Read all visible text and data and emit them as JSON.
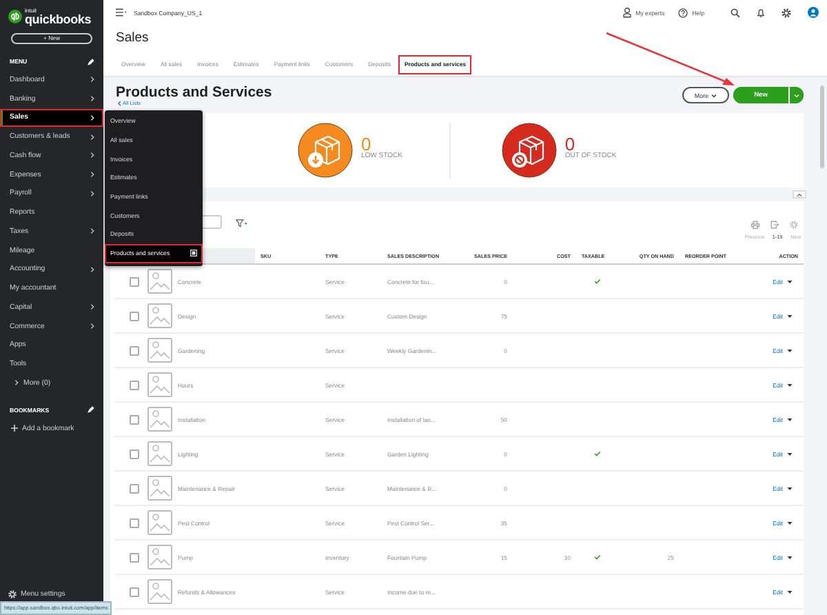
{
  "sidebar": {
    "logo": {
      "maker": "intuit",
      "brand": "quickbooks"
    },
    "new_button": "+ New",
    "menu_heading": "MENU",
    "items": [
      {
        "label": "Dashboard",
        "submenu": true,
        "selected": false,
        "annotated": false
      },
      {
        "label": "Banking",
        "submenu": true,
        "selected": false,
        "annotated": false
      },
      {
        "label": "Sales",
        "submenu": true,
        "selected": true,
        "annotated": true
      },
      {
        "label": "Customers & leads",
        "submenu": true,
        "selected": false,
        "annotated": false
      },
      {
        "label": "Cash flow",
        "submenu": true,
        "selected": false,
        "annotated": false
      },
      {
        "label": "Expenses",
        "submenu": true,
        "selected": false,
        "annotated": false
      },
      {
        "label": "Payroll",
        "submenu": true,
        "selected": false,
        "annotated": false
      },
      {
        "label": "Reports",
        "submenu": false,
        "selected": false,
        "annotated": false
      },
      {
        "label": "Taxes",
        "submenu": true,
        "selected": false,
        "annotated": false
      },
      {
        "label": "Mileage",
        "submenu": false,
        "selected": false,
        "annotated": false
      },
      {
        "label": "Accounting",
        "submenu": true,
        "selected": false,
        "annotated": false
      },
      {
        "label": "My accountant",
        "submenu": false,
        "selected": false,
        "annotated": false
      },
      {
        "label": "Capital",
        "submenu": true,
        "selected": false,
        "annotated": false
      },
      {
        "label": "Commerce",
        "submenu": true,
        "selected": false,
        "annotated": false
      },
      {
        "label": "Apps",
        "submenu": false,
        "selected": false,
        "annotated": false
      },
      {
        "label": "Tools",
        "submenu": false,
        "selected": false,
        "annotated": false
      }
    ],
    "more": "More (0)",
    "bookmarks_heading": "BOOKMARKS",
    "add_bookmark": "Add a bookmark",
    "settings": "Menu settings"
  },
  "flyout": {
    "items": [
      {
        "label": "Overview",
        "selected": false,
        "annotated": false
      },
      {
        "label": "All sales",
        "selected": false,
        "annotated": false
      },
      {
        "label": "Invoices",
        "selected": false,
        "annotated": false
      },
      {
        "label": "Estimates",
        "selected": false,
        "annotated": false
      },
      {
        "label": "Payment links",
        "selected": false,
        "annotated": false
      },
      {
        "label": "Customers",
        "selected": false,
        "annotated": false
      },
      {
        "label": "Deposits",
        "selected": false,
        "annotated": false
      },
      {
        "label": "Products and services",
        "selected": true,
        "annotated": true
      }
    ]
  },
  "topbar": {
    "company": "Sandbox Company_US_1",
    "experts": "My experts",
    "help": "Help"
  },
  "page_title": "Sales",
  "tabs": [
    {
      "label": "Overview",
      "selected": false,
      "annotated": false
    },
    {
      "label": "All sales",
      "selected": false,
      "annotated": false
    },
    {
      "label": "Invoices",
      "selected": false,
      "annotated": false
    },
    {
      "label": "Estimates",
      "selected": false,
      "annotated": false
    },
    {
      "label": "Payment links",
      "selected": false,
      "annotated": false
    },
    {
      "label": "Customers",
      "selected": false,
      "annotated": false
    },
    {
      "label": "Deposits",
      "selected": false,
      "annotated": false
    },
    {
      "label": "Products and services",
      "selected": true,
      "annotated": true
    }
  ],
  "section": {
    "title": "Products and Services",
    "back_link": "All Lists",
    "more_button": "More",
    "new_button": "New"
  },
  "stock": [
    {
      "kind": "low",
      "count": "0",
      "label": "LOW STOCK"
    },
    {
      "kind": "out",
      "count": "0",
      "label": "OUT OF STOCK"
    }
  ],
  "table": {
    "pagination": {
      "previous": "Previous",
      "range": "1-19",
      "next": "Next"
    },
    "columns": [
      "SKU",
      "TYPE",
      "SALES DESCRIPTION",
      "SALES PRICE",
      "COST",
      "TAXABLE",
      "QTY ON HAND",
      "REORDER POINT",
      "ACTION"
    ],
    "rows": [
      {
        "checked": false,
        "name": "Concrete",
        "type": "Service",
        "description": "Concrete for fou...",
        "price": "0",
        "cost": "",
        "taxable": true,
        "qty": "",
        "action": "Edit"
      },
      {
        "checked": false,
        "name": "Design",
        "type": "Service",
        "description": "Custom Design",
        "price": "75",
        "cost": "",
        "taxable": false,
        "qty": "",
        "action": "Edit"
      },
      {
        "checked": false,
        "name": "Gardening",
        "type": "Service",
        "description": "Weekly Gardenin...",
        "price": "0",
        "cost": "",
        "taxable": false,
        "qty": "",
        "action": "Edit"
      },
      {
        "checked": false,
        "name": "Hours",
        "type": "Service",
        "description": "",
        "price": "",
        "cost": "",
        "taxable": false,
        "qty": "",
        "action": "Edit"
      },
      {
        "checked": false,
        "name": "Installation",
        "type": "Service",
        "description": "Installation of lan...",
        "price": "50",
        "cost": "",
        "taxable": false,
        "qty": "",
        "action": "Edit"
      },
      {
        "checked": false,
        "name": "Lighting",
        "type": "Service",
        "description": "Garden Lighting",
        "price": "0",
        "cost": "",
        "taxable": true,
        "qty": "",
        "action": "Edit"
      },
      {
        "checked": false,
        "name": "Maintenance & Repair",
        "type": "Service",
        "description": "Maintenance & R...",
        "price": "0",
        "cost": "",
        "taxable": false,
        "qty": "",
        "action": "Edit"
      },
      {
        "checked": false,
        "name": "Pest Control",
        "type": "Service",
        "description": "Pest Control Ser...",
        "price": "35",
        "cost": "",
        "taxable": false,
        "qty": "",
        "action": "Edit"
      },
      {
        "checked": false,
        "name": "Pump",
        "type": "Inventory",
        "description": "Fountain Pump",
        "price": "15",
        "cost": "10",
        "taxable": true,
        "qty": "25",
        "action": "Edit"
      },
      {
        "checked": false,
        "name": "Refunds & Allowances",
        "type": "Service",
        "description": "Income due to re...",
        "price": "",
        "cost": "",
        "taxable": false,
        "qty": "",
        "action": "Edit"
      }
    ]
  },
  "status_url": "https://app.sandbox.qbo.intuit.com/app/items"
}
